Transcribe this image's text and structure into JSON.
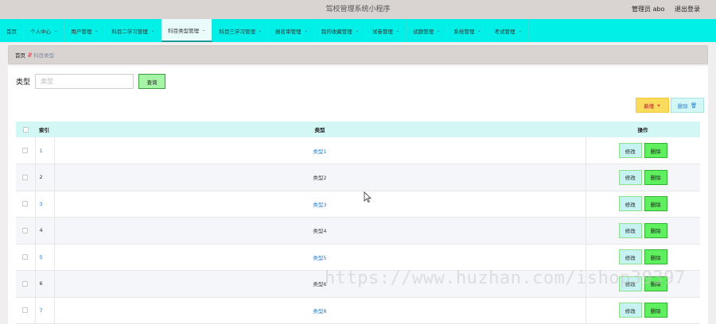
{
  "header": {
    "title": "驾校管理系统小程序",
    "user_label": "管理员 abo",
    "logout_label": "退出登录"
  },
  "nav": {
    "items": [
      {
        "label": "首页",
        "dropdown": false,
        "active": false
      },
      {
        "label": "个人中心",
        "dropdown": true,
        "active": false
      },
      {
        "label": "用户管理",
        "dropdown": true,
        "active": false
      },
      {
        "label": "科目二学习管理",
        "dropdown": true,
        "active": false
      },
      {
        "label": "科目类型管理",
        "dropdown": true,
        "active": true
      },
      {
        "label": "科目三学习管理",
        "dropdown": true,
        "active": false
      },
      {
        "label": "报名审管理",
        "dropdown": true,
        "active": false
      },
      {
        "label": "我的收藏管理",
        "dropdown": true,
        "active": false
      },
      {
        "label": "试卷管理",
        "dropdown": true,
        "active": false
      },
      {
        "label": "试题管理",
        "dropdown": true,
        "active": false
      },
      {
        "label": "系统管理",
        "dropdown": true,
        "active": false
      },
      {
        "label": "考试管理",
        "dropdown": true,
        "active": false
      }
    ]
  },
  "breadcrumb": {
    "home": "首页",
    "separator": "////",
    "current": "科目类型"
  },
  "search": {
    "label": "类型",
    "placeholder": "类型",
    "button": "查询"
  },
  "actions": {
    "add_label": "新增",
    "add_icon": "+",
    "delete_label": "删除",
    "delete_icon": "🗑"
  },
  "table": {
    "columns": [
      "索引",
      "类型",
      "操作"
    ],
    "edit_label": "修改",
    "delete_label": "删除",
    "rows": [
      {
        "index": "1",
        "type": "类型1",
        "link": true
      },
      {
        "index": "2",
        "type": "类型2",
        "link": false
      },
      {
        "index": "3",
        "type": "类型3",
        "link": true
      },
      {
        "index": "4",
        "type": "类型4",
        "link": false
      },
      {
        "index": "5",
        "type": "类型5",
        "link": true
      },
      {
        "index": "6",
        "type": "类型6",
        "link": false
      },
      {
        "index": "7",
        "type": "类型8",
        "link": true
      }
    ]
  },
  "watermark": "https://www.huzhan.com/ishop39397",
  "colors": {
    "nav_bg": "#00f0e8",
    "header_bg": "#d9d4d2",
    "table_head_bg": "#d2f7f5",
    "add_button": "#f9dc5c",
    "remove_button": "#5ef05e",
    "link": "#2b7fd1"
  }
}
